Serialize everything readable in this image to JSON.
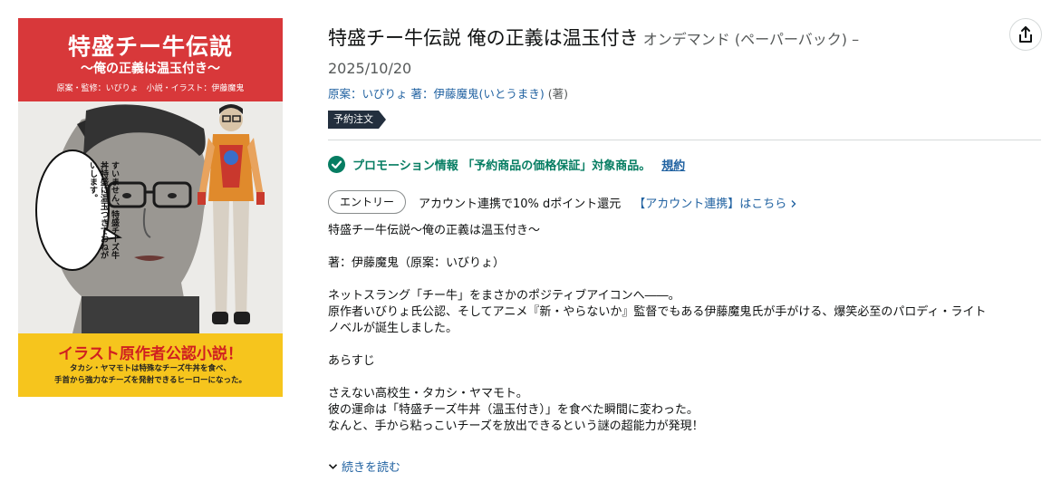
{
  "cover": {
    "title": "特盛チー牛伝説",
    "subtitle": "〜俺の正義は温玉付き〜",
    "credit": "原案・監修：いびりょ　小説・イラスト：伊藤魔鬼",
    "speech_bubble": "すいません、特盛チーズ牛丼特盛に温玉つきでおねがいします。",
    "tagline": "イラスト原作者公認小説！",
    "blurb_line1": "タカシ・ヤマモトは特殊なチーズ牛丼を食べ、",
    "blurb_line2": "手首から強力なチーズを発射できるヒーローになった。"
  },
  "product": {
    "title": "特盛チー牛伝説 俺の正義は温玉付き",
    "binding": "オンデマンド (ペーパーバック) –",
    "date": "2025/10/20",
    "author1_role": "原案：",
    "author1_name": "いびりょ",
    "author2_role": "著：",
    "author2_name": "伊藤魔鬼(いとうまき)",
    "author2_suffix": "(著)",
    "badge": "予約注文"
  },
  "promo": {
    "text": "プロモーション情報 「予約商品の価格保証」対象商品。",
    "link": "規約",
    "icon": "check-circle-icon"
  },
  "entry": {
    "button": "エントリー",
    "text": "アカウント連携で10% dポイント還元",
    "link": "【アカウント連携】はこちら",
    "link_icon": "chevron-right-icon"
  },
  "description": {
    "lines": [
      "特盛チー牛伝説〜俺の正義は温玉付き〜",
      "",
      "著：伊藤魔鬼（原案：いびりょ）",
      "",
      "ネットスラング「チー牛」をまさかのポジティブアイコンへ――。",
      "原作者いびりょ氏公認、そしてアニメ『新・やらないか』監督でもある伊藤魔鬼氏が手がける、爆笑必至のパロディ・ライト",
      "ノベルが誕生しました。",
      "",
      "あらすじ",
      "",
      "さえない高校生・タカシ・ヤマモト。",
      "彼の運命は「特盛チーズ牛丼（温玉付き）」を食べた瞬間に変わった。",
      "なんと、手から粘っこいチーズを放出できるという謎の超能力が発現！"
    ],
    "read_more": "続きを読む"
  },
  "actions": {
    "share_icon": "share-icon"
  },
  "colors": {
    "link": "#2162a1",
    "promo_green": "#067d62",
    "badge_bg": "#232f3e",
    "cover_red": "#d8383a",
    "cover_yellow": "#f6c51d"
  }
}
